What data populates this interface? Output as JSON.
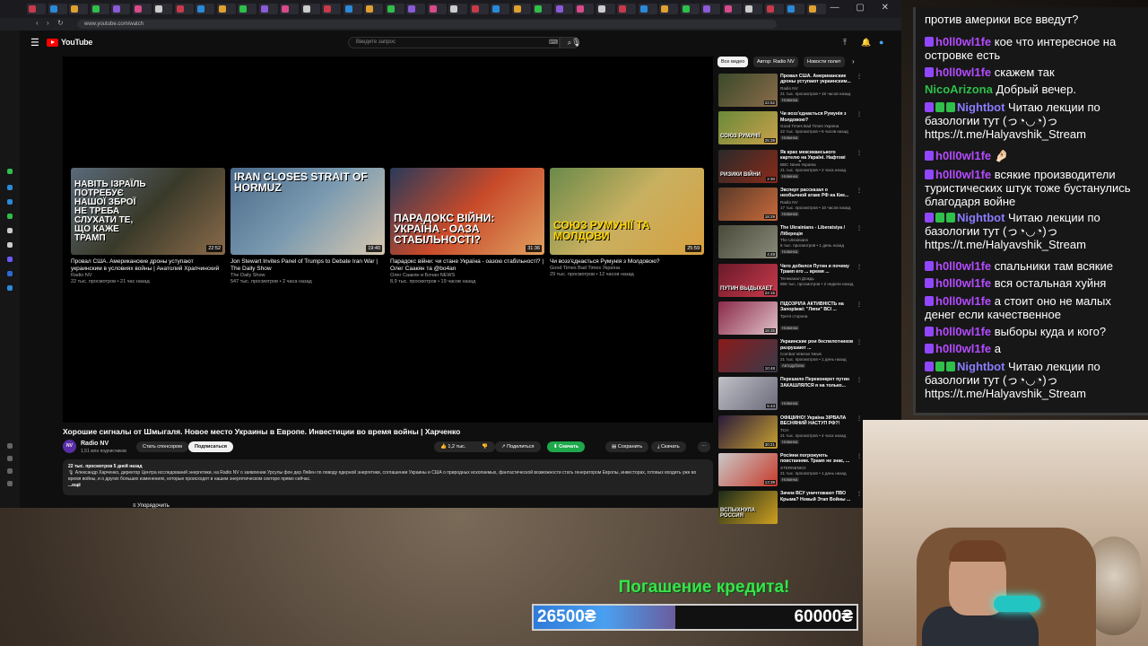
{
  "browser": {
    "url": "www.youtube.com/watch",
    "window_controls": "— ▢ ✕"
  },
  "youtube": {
    "logo_text": "YouTube",
    "search_placeholder": "Введите запрос"
  },
  "player": {
    "endcards": [
      {
        "caption": "НАВІТЬ ІЗРАЇЛЬ ПОТРЕБУЄ НАШОЇ ЗБРОЇ НЕ ТРЕБА СЛУХАТИ ТЕ, ЩО КАЖЕ ТРАМП",
        "duration": "22:52",
        "title": "Провал США. Американские дроны уступают украинским в условиях войны | Анатолий Храпчинский",
        "channel": "Radio NV",
        "meta": "22 тыс. просмотров • 21 час назад"
      },
      {
        "caption": "IRAN CLOSES STRAIT OF HORMUZ",
        "duration": "19:40",
        "title": "Jon Stewart Invites Panel of Trumps to Debate Iran War | The Daily Show",
        "channel": "The Daily Show",
        "meta": "547 тыс. просмотров • 2 часа назад"
      },
      {
        "caption": "ПАРАДОКС ВІЙНИ: УКРАЇНА - ОАЗА СТАБІЛЬНОСТІ?",
        "duration": "31:36",
        "title": "Парадокс війни: чи стане Україна - оазою стабільності? | Олег Саакян та @bo4an",
        "channel": "Олег Саакян и Бочан NEWS",
        "meta": "8,9 тыс. просмотров • 19 часов назад"
      },
      {
        "caption": "СОЮЗ РУМУНІЇ ТА МОЛДОВИ",
        "duration": "25:59",
        "title": "Чи возз'єднається Румунія з Молдовою?",
        "channel": "Good Times Bad Times Україна",
        "meta": "29 тыс. просмотров • 12 часов назад"
      }
    ]
  },
  "video": {
    "title": "Хорошие сигналы от Шмыгаля. Новое место Украины в Европе. Инвестиции во время войны | Харченко",
    "channel": "Radio NV",
    "subscribers": "1,51 млн подписчиков",
    "sponsor_label": "Стать спонсором",
    "subscribe_label": "Подписаться",
    "likes": "1,2 тыс.",
    "share_label": "Поделиться",
    "download_label": "Скачать",
    "save_label": "Сохранить",
    "download2_label": "Скачать",
    "desc_meta": "22 тыс. просмотров  5 дней назад",
    "desc_text": "🎙 Александр Харченко, директор Центра исследований энергетики, на Radio NV о заявлении Урсулы фон дер Ляйен по поводу ядерной энергетики, соглашении Украины и США о природных ископаемых, фантастической возможности стать генератором Европы, инвесторах, готовых входить уже во время войны, и о других больших изменениях, которые происходят в нашем энергетическом секторе прямо сейчас.",
    "desc_more": "...ещё",
    "comments_label": "Упорядочить"
  },
  "chips": [
    "Все видео",
    "Автор: Radio NV",
    "Новости полит"
  ],
  "recommendations": [
    {
      "title": "Провал США. Американские дроны уступают украинским...",
      "channel": "Radio NV",
      "meta": "21 тыс. просмотров • 15 часов назад",
      "badge": "Новинка",
      "duration": "22:52",
      "caption": "",
      "c1": "#3a4a2a",
      "c2": "#8a6b4a"
    },
    {
      "title": "Чи возз'єднається Румунія з Молдовою?",
      "channel": "Good Times Bad Times Україна",
      "meta": "22 тыс. просмотров • 6 часов назад",
      "badge": "Новинка",
      "duration": "25:39",
      "caption": "СОЮЗ РУМУНІЇ",
      "c1": "#6a8a3a",
      "c2": "#c8a04a"
    },
    {
      "title": "Як крах мексиканського картелю на Україні. Нафтові танкери?",
      "channel": "BBC News Україна",
      "meta": "21 тыс. просмотров • 2 часа назад",
      "badge": "Новинка",
      "duration": "2:30",
      "caption": "РИЗИКИ ВІЙНИ",
      "c1": "#2a2a2a",
      "c2": "#8a2a1a"
    },
    {
      "title": "Эксперт рассказал о необычной атаке РФ на Кие...",
      "channel": "Radio NV",
      "meta": "17 тыс. просмотров • 10 часов назад",
      "badge": "Новинка",
      "duration": "18:29",
      "caption": "",
      "c1": "#5a3a2a",
      "c2": "#c86a3a"
    },
    {
      "title": "The Ukrainians - Liberatsiya / Лібереція",
      "channel": "The Ukrainians",
      "meta": "5 тыс. просмотров • 1 день назад",
      "badge": "Новинка",
      "duration": "4:49",
      "caption": "",
      "c1": "#4a4a3a",
      "c2": "#8a8a7a"
    },
    {
      "title": "Чего добился Путин и почему Трамп его ... время ...",
      "channel": "Телеканал Дождь",
      "meta": "566 тыс. просмотров • 2 недели назад",
      "badge": "",
      "duration": "22:15",
      "caption": "ПУТИН ВЫДЫХАЕТ",
      "c1": "#6a1a2a",
      "c2": "#c83a4a"
    },
    {
      "title": "ПІДОЗРІЛА АКТИВНІСТЬ на Запоріжжі: \"Ляпи\" ВСІ ...",
      "channel": "Третя сторона",
      "meta": "",
      "badge": "Новинка",
      "duration": "18:35",
      "caption": "",
      "c1": "#8a2a4a",
      "c2": "#e0c0c8"
    },
    {
      "title": "Украинские рои беспилотников разрушают ...",
      "channel": "Combat Veteran News",
      "meta": "21 тыс. просмотров • 1 день назад",
      "badge": "Автодубляж",
      "duration": "10:48",
      "caption": "",
      "c1": "#8a1a1a",
      "c2": "#3a3a4a"
    },
    {
      "title": "Перешило Переконкрет путин ЗАКАШЛЯЛСЯ я на только...",
      "channel": "",
      "meta": "",
      "badge": "Новинка",
      "duration": "5:43",
      "caption": "",
      "c1": "#c0c0c8",
      "c2": "#6a6a7a"
    },
    {
      "title": "ОФІЦІЙНО! Україна ЗІРВАЛА ВЕСНЯНИЙ НАСТУП РФ?! Армія ...",
      "channel": "ТСН",
      "meta": "21 тыс. просмотров • 4 часа назад",
      "badge": "Новинка",
      "duration": "30:21",
      "caption": "",
      "c1": "#2a1a3a",
      "c2": "#c8a030"
    },
    {
      "title": "Росіяни погрожують повстанням. Трамп не знає, ...",
      "channel": "STERNENKO",
      "meta": "21 тыс. просмотров • 1 день назад",
      "badge": "Новинка",
      "duration": "13:39",
      "caption": "",
      "c1": "#c8c8c8",
      "c2": "#c83a2a"
    },
    {
      "title": "Зачем ВСУ уничтожают ПВО Крыма? Новый Этап Войны ...",
      "channel": "",
      "meta": "",
      "badge": "",
      "duration": "",
      "caption": "ВСПЫХНУЛА РОССИЯ",
      "c1": "#1a2a1a",
      "c2": "#d0a020"
    }
  ],
  "chat": {
    "messages": [
      {
        "user": "",
        "text": "против америки все введут?",
        "user_color": "#ffffff",
        "badges": 0
      },
      {
        "user": "h0ll0wl1fe",
        "text": "кое что интересное на островке есть",
        "user_color": "#b44bff",
        "badges": 1
      },
      {
        "user": "h0ll0wl1fe",
        "text": "скажем так",
        "user_color": "#b44bff",
        "badges": 1
      },
      {
        "user": "NicoArizona",
        "text": "Добрый вечер.",
        "user_color": "#2fbf4a",
        "badges": 0
      },
      {
        "user": "Nightbot",
        "text": "Читаю лекции по базологии тут (っ◔◡◔)っ https://t.me/Halyavshik_Stream",
        "user_color": "#8a7cff",
        "badges": 3
      },
      {
        "user": "h0ll0wl1fe",
        "text": "🤌🏻",
        "user_color": "#b44bff",
        "badges": 1
      },
      {
        "user": "h0ll0wl1fe",
        "text": "всякие производители туристических штук тоже бустанулись благодаря войне",
        "user_color": "#b44bff",
        "badges": 1
      },
      {
        "user": "Nightbot",
        "text": "Читаю лекции по базологии тут (っ◔◡◔)っ https://t.me/Halyavshik_Stream",
        "user_color": "#8a7cff",
        "badges": 3
      },
      {
        "user": "h0ll0wl1fe",
        "text": "спальники там всякие",
        "user_color": "#b44bff",
        "badges": 1
      },
      {
        "user": "h0ll0wl1fe",
        "text": "вся остальная хуйня",
        "user_color": "#b44bff",
        "badges": 1
      },
      {
        "user": "h0ll0wl1fe",
        "text": "а стоит оно не малых денег если качественное",
        "user_color": "#b44bff",
        "badges": 1
      },
      {
        "user": "h0ll0wl1fe",
        "text": "выборы куда и кого?",
        "user_color": "#b44bff",
        "badges": 1
      },
      {
        "user": "h0ll0wl1fe",
        "text": "а",
        "user_color": "#b44bff",
        "badges": 1
      },
      {
        "user": "Nightbot",
        "text": "Читаю лекции по базологии тут (っ◔◡◔)っ https://t.me/Halyavshik_Stream",
        "user_color": "#8a7cff",
        "badges": 3
      }
    ]
  },
  "goal": {
    "title": "Погашение кредита!",
    "current": "26500₴",
    "target": "60000₴",
    "progress_fraction": 0.44
  }
}
